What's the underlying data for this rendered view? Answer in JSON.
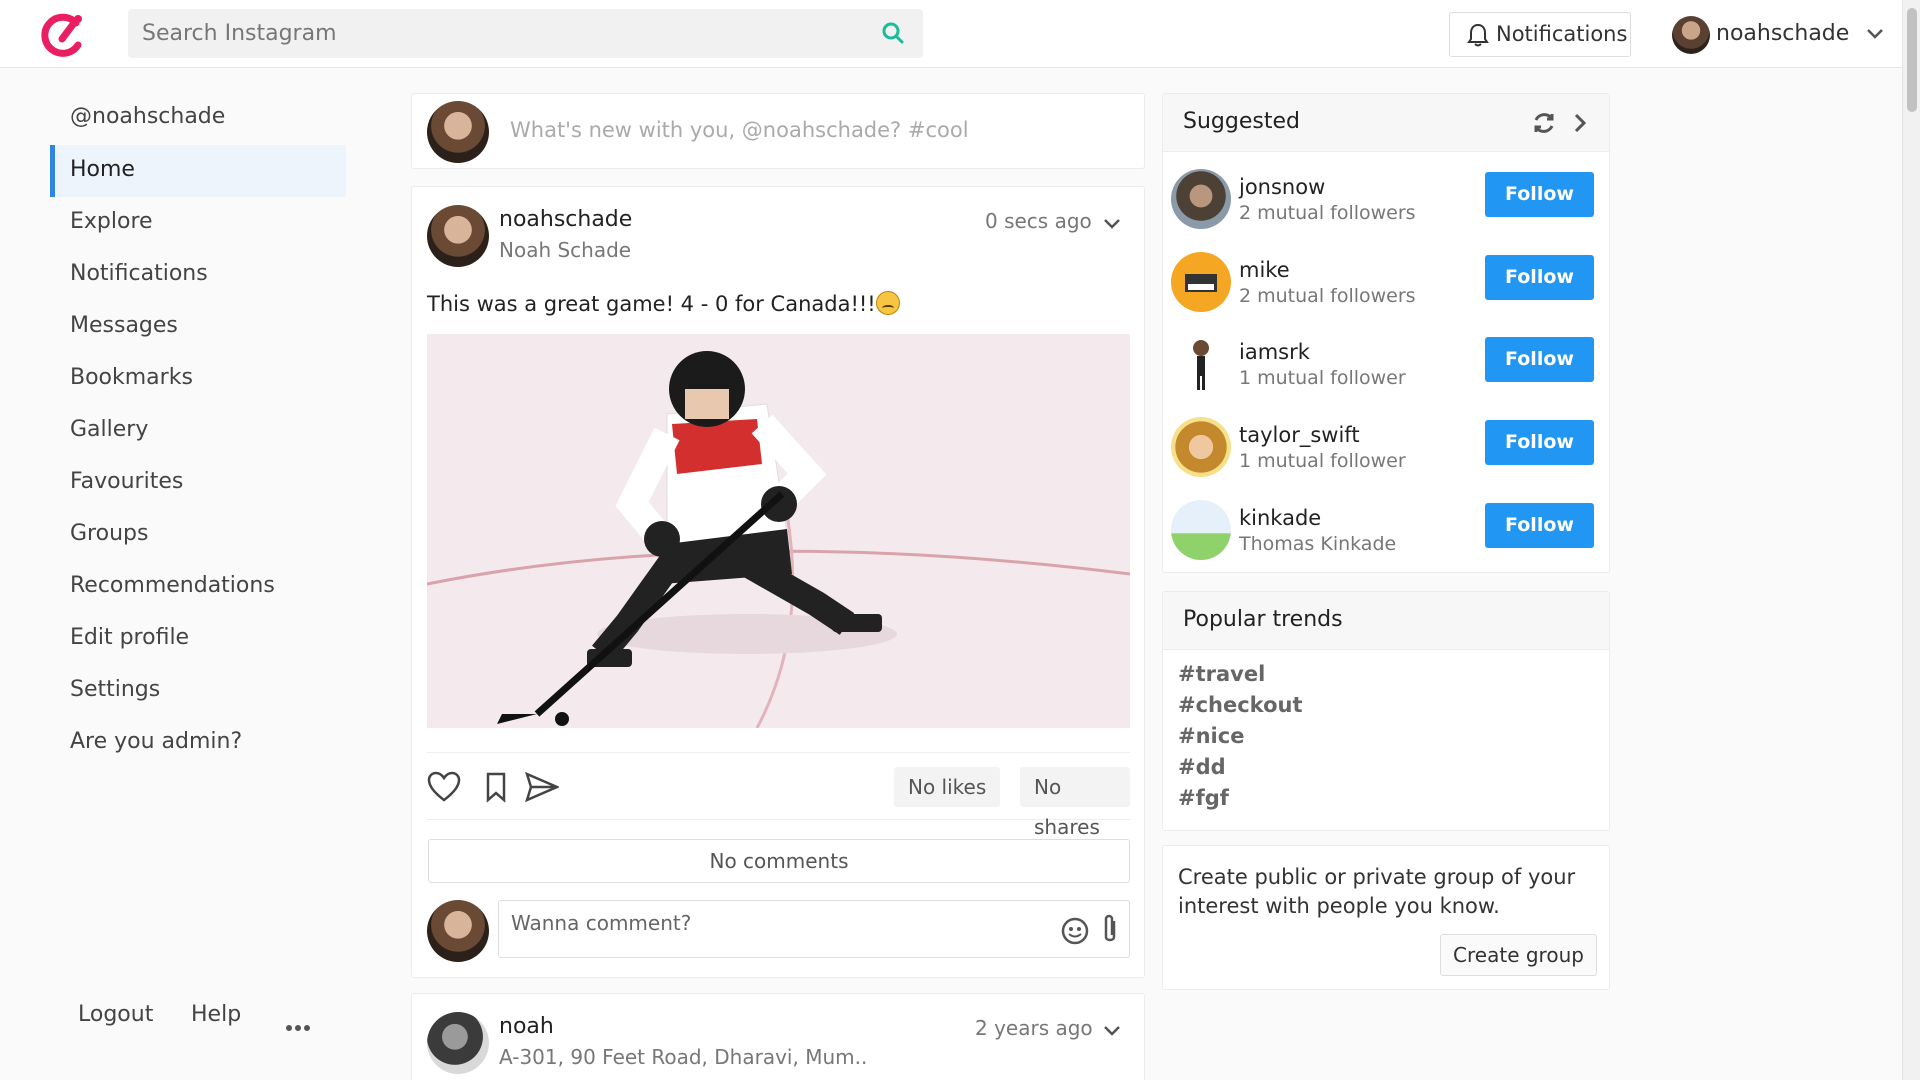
{
  "search": {
    "placeholder": "Search Instagram"
  },
  "header": {
    "notifications_label": "Notifications",
    "username": "noahschade"
  },
  "sidebar": {
    "handle": "@noahschade",
    "items": [
      {
        "label": "Home",
        "active": true
      },
      {
        "label": "Explore"
      },
      {
        "label": "Notifications"
      },
      {
        "label": "Messages"
      },
      {
        "label": "Bookmarks"
      },
      {
        "label": "Gallery"
      },
      {
        "label": "Favourites"
      },
      {
        "label": "Groups"
      },
      {
        "label": "Recommendations"
      },
      {
        "label": "Edit profile"
      },
      {
        "label": "Settings"
      },
      {
        "label": "Are you admin?"
      }
    ],
    "footer": {
      "logout": "Logout",
      "help": "Help"
    }
  },
  "composer": {
    "placeholder": "What's new with you, @noahschade? #cool"
  },
  "post": {
    "username": "noahschade",
    "fullname": "Noah Schade",
    "time": "0 secs ago",
    "text": "This was a great game! 4 - 0 for Canada!!!",
    "likes": "No likes",
    "shares": "No shares",
    "comments": "No comments",
    "comment_placeholder": "Wanna comment?"
  },
  "post2": {
    "username": "noah",
    "subtitle": "A-301, 90 Feet Road, Dharavi, Mum..",
    "time": "2 years ago"
  },
  "suggested": {
    "title": "Suggested",
    "follow_label": "Follow",
    "users": [
      {
        "username": "jonsnow",
        "info": "2 mutual followers"
      },
      {
        "username": "mike",
        "info": "2 mutual followers"
      },
      {
        "username": "iamsrk",
        "info": "1 mutual follower"
      },
      {
        "username": "taylor_swift",
        "info": "1 mutual follower"
      },
      {
        "username": "kinkade",
        "info": "Thomas Kinkade"
      }
    ]
  },
  "trends": {
    "title": "Popular trends",
    "tags": [
      "#travel",
      "#checkout",
      "#nice",
      "#dd",
      "#fgf"
    ]
  },
  "group": {
    "text": "Create public or private group of your interest with people you know.",
    "button": "Create group"
  },
  "colors": {
    "accent": "#e91e63",
    "follow": "#2196f3",
    "search_icon": "#1abc9c",
    "active_nav": "#2e86de"
  }
}
